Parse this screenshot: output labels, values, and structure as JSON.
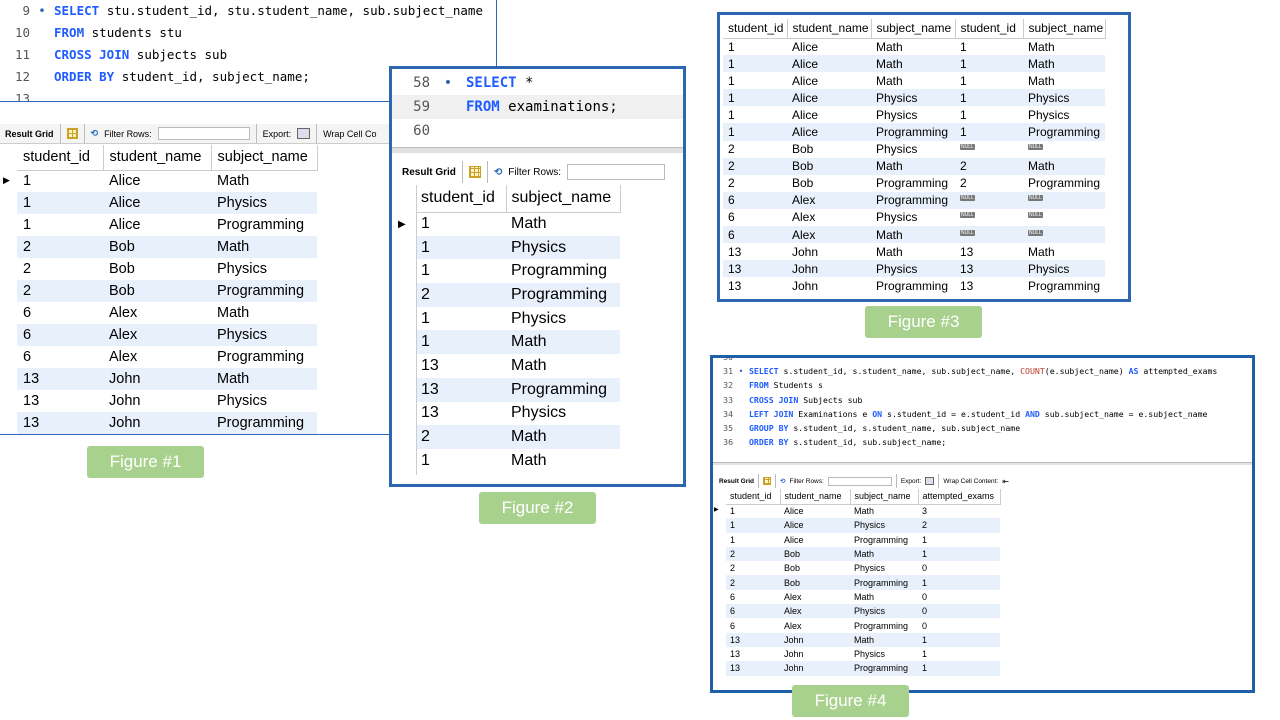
{
  "fig1": {
    "label": "Figure #1",
    "lines": [
      {
        "num": "9",
        "marker": "•",
        "parts": [
          [
            "kw",
            "SELECT"
          ],
          [
            "",
            "stu.student_id, stu.student_name, sub.subject_name"
          ]
        ]
      },
      {
        "num": "10",
        "marker": "",
        "parts": [
          [
            "kw",
            "FROM"
          ],
          [
            "",
            "students stu"
          ]
        ]
      },
      {
        "num": "11",
        "marker": "",
        "parts": [
          [
            "kw",
            "CROSS JOIN"
          ],
          [
            "",
            "subjects sub"
          ]
        ]
      },
      {
        "num": "12",
        "marker": "",
        "parts": [
          [
            "kw",
            "ORDER BY"
          ],
          [
            "",
            "student_id, subject_name;"
          ]
        ]
      },
      {
        "num": "13",
        "marker": "",
        "parts": []
      }
    ],
    "toolbar": {
      "result_grid": "Result Grid",
      "filter_rows": "Filter Rows:",
      "export": "Export:",
      "wrap": "Wrap Cell Co"
    },
    "columns": [
      "student_id",
      "student_name",
      "subject_name"
    ],
    "rows": [
      [
        "1",
        "Alice",
        "Math"
      ],
      [
        "1",
        "Alice",
        "Physics"
      ],
      [
        "1",
        "Alice",
        "Programming"
      ],
      [
        "2",
        "Bob",
        "Math"
      ],
      [
        "2",
        "Bob",
        "Physics"
      ],
      [
        "2",
        "Bob",
        "Programming"
      ],
      [
        "6",
        "Alex",
        "Math"
      ],
      [
        "6",
        "Alex",
        "Physics"
      ],
      [
        "6",
        "Alex",
        "Programming"
      ],
      [
        "13",
        "John",
        "Math"
      ],
      [
        "13",
        "John",
        "Physics"
      ],
      [
        "13",
        "John",
        "Programming"
      ]
    ]
  },
  "fig2": {
    "label": "Figure #2",
    "lines": [
      {
        "num": "58",
        "marker": "•",
        "parts": [
          [
            "kw",
            "SELECT"
          ],
          [
            "",
            "*"
          ]
        ]
      },
      {
        "num": "59",
        "marker": "",
        "parts": [
          [
            "kw",
            "FROM"
          ],
          [
            "",
            "examinations;"
          ]
        ]
      },
      {
        "num": "60",
        "marker": "",
        "parts": []
      }
    ],
    "toolbar": {
      "result_grid": "Result Grid",
      "filter_rows": "Filter Rows:"
    },
    "columns": [
      "student_id",
      "subject_name"
    ],
    "rows": [
      [
        "1",
        "Math"
      ],
      [
        "1",
        "Physics"
      ],
      [
        "1",
        "Programming"
      ],
      [
        "2",
        "Programming"
      ],
      [
        "1",
        "Physics"
      ],
      [
        "1",
        "Math"
      ],
      [
        "13",
        "Math"
      ],
      [
        "13",
        "Programming"
      ],
      [
        "13",
        "Physics"
      ],
      [
        "2",
        "Math"
      ],
      [
        "1",
        "Math"
      ]
    ]
  },
  "fig3": {
    "label": "Figure #3",
    "null_text": "NULL",
    "columns": [
      "student_id",
      "student_name",
      "subject_name",
      "student_id",
      "subject_name"
    ],
    "rows": [
      [
        "1",
        "Alice",
        "Math",
        "1",
        "Math"
      ],
      [
        "1",
        "Alice",
        "Math",
        "1",
        "Math"
      ],
      [
        "1",
        "Alice",
        "Math",
        "1",
        "Math"
      ],
      [
        "1",
        "Alice",
        "Physics",
        "1",
        "Physics"
      ],
      [
        "1",
        "Alice",
        "Physics",
        "1",
        "Physics"
      ],
      [
        "1",
        "Alice",
        "Programming",
        "1",
        "Programming"
      ],
      [
        "2",
        "Bob",
        "Physics",
        null,
        null
      ],
      [
        "2",
        "Bob",
        "Math",
        "2",
        "Math"
      ],
      [
        "2",
        "Bob",
        "Programming",
        "2",
        "Programming"
      ],
      [
        "6",
        "Alex",
        "Programming",
        null,
        null
      ],
      [
        "6",
        "Alex",
        "Physics",
        null,
        null
      ],
      [
        "6",
        "Alex",
        "Math",
        null,
        null
      ],
      [
        "13",
        "John",
        "Math",
        "13",
        "Math"
      ],
      [
        "13",
        "John",
        "Physics",
        "13",
        "Physics"
      ],
      [
        "13",
        "John",
        "Programming",
        "13",
        "Programming"
      ]
    ]
  },
  "fig4": {
    "label": "Figure #4",
    "lines": [
      {
        "num": "30",
        "marker": "",
        "parts": []
      },
      {
        "num": "31",
        "marker": "•",
        "parts": [
          [
            "kw",
            "SELECT"
          ],
          [
            "",
            "s.student_id, s.student_name, sub.subject_name, "
          ],
          [
            "fn",
            "COUNT"
          ],
          [
            "",
            "(e.subject_name) "
          ],
          [
            "kw",
            "AS"
          ],
          [
            "",
            "attempted_exams"
          ]
        ]
      },
      {
        "num": "32",
        "marker": "",
        "parts": [
          [
            "kw",
            "FROM"
          ],
          [
            "",
            "Students s"
          ]
        ]
      },
      {
        "num": "33",
        "marker": "",
        "parts": [
          [
            "kw",
            "CROSS JOIN"
          ],
          [
            "",
            "Subjects sub"
          ]
        ]
      },
      {
        "num": "34",
        "marker": "",
        "parts": [
          [
            "kw",
            "LEFT JOIN"
          ],
          [
            "",
            "Examinations e "
          ],
          [
            "kw",
            "ON"
          ],
          [
            "",
            "s.student_id = e.student_id "
          ],
          [
            "kw",
            "AND"
          ],
          [
            "",
            "sub.subject_name = e.subject_name"
          ]
        ]
      },
      {
        "num": "35",
        "marker": "",
        "parts": [
          [
            "kw",
            "GROUP BY"
          ],
          [
            "",
            "s.student_id, s.student_name, sub.subject_name"
          ]
        ]
      },
      {
        "num": "36",
        "marker": "",
        "parts": [
          [
            "kw",
            "ORDER BY"
          ],
          [
            "",
            "s.student_id, sub.subject_name;"
          ]
        ]
      }
    ],
    "toolbar": {
      "result_grid": "Result Grid",
      "filter_rows": "Filter Rows:",
      "export": "Export:",
      "wrap": "Wrap Cell Content:"
    },
    "columns": [
      "student_id",
      "student_name",
      "subject_name",
      "attempted_exams"
    ],
    "rows": [
      [
        "1",
        "Alice",
        "Math",
        "3"
      ],
      [
        "1",
        "Alice",
        "Physics",
        "2"
      ],
      [
        "1",
        "Alice",
        "Programming",
        "1"
      ],
      [
        "2",
        "Bob",
        "Math",
        "1"
      ],
      [
        "2",
        "Bob",
        "Physics",
        "0"
      ],
      [
        "2",
        "Bob",
        "Programming",
        "1"
      ],
      [
        "6",
        "Alex",
        "Math",
        "0"
      ],
      [
        "6",
        "Alex",
        "Physics",
        "0"
      ],
      [
        "6",
        "Alex",
        "Programming",
        "0"
      ],
      [
        "13",
        "John",
        "Math",
        "1"
      ],
      [
        "13",
        "John",
        "Physics",
        "1"
      ],
      [
        "13",
        "John",
        "Programming",
        "1"
      ]
    ]
  },
  "colors": {
    "frame": "#2e67b1",
    "label_bg": "#a9d18e",
    "keyword": "#1f5cff",
    "row_alt": "#e8f0fb"
  }
}
